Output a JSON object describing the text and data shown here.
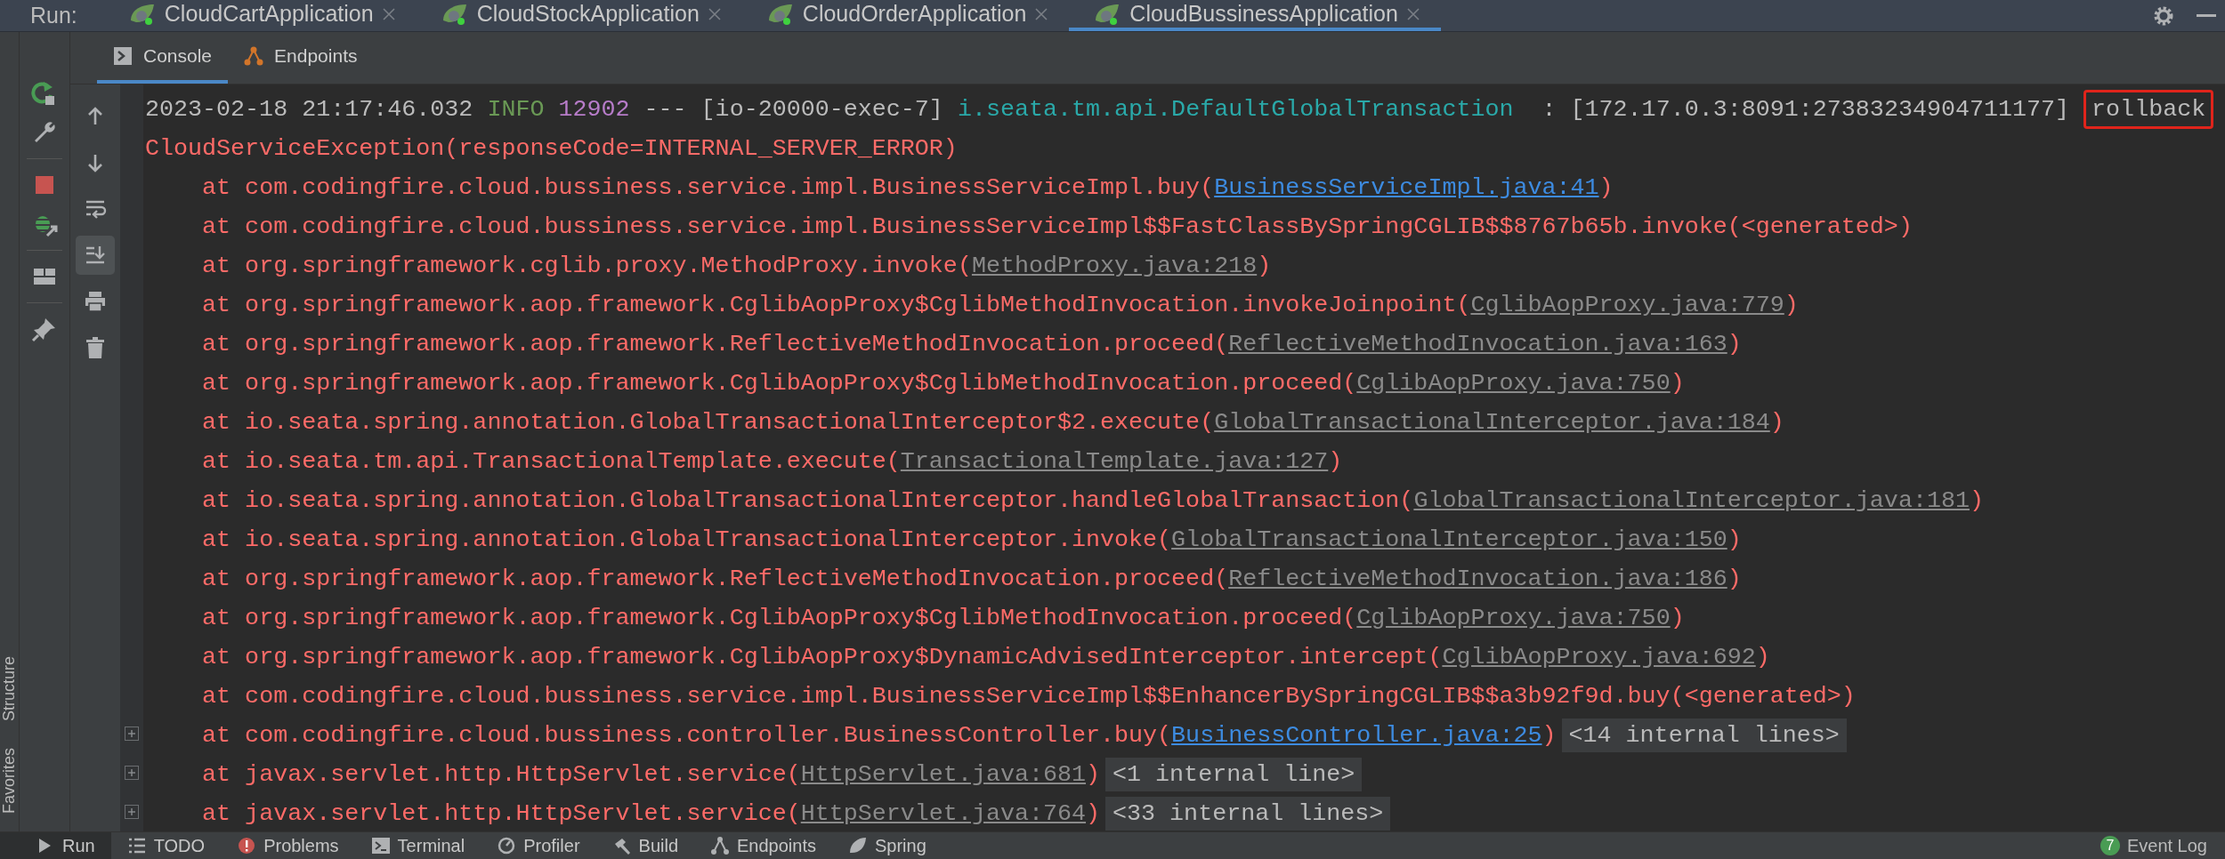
{
  "run_label": "Run:",
  "run_tabs": [
    {
      "label": "CloudCartApplication",
      "selected": false
    },
    {
      "label": "CloudStockApplication",
      "selected": false
    },
    {
      "label": "CloudOrderApplication",
      "selected": false
    },
    {
      "label": "CloudBussinessApplication",
      "selected": true
    }
  ],
  "side_strip": [
    "Structure",
    "Favorites"
  ],
  "run_toolbar": [
    {
      "kind": "rerun"
    },
    {
      "kind": "wrench"
    },
    {
      "kind": "sep"
    },
    {
      "kind": "stop"
    },
    {
      "kind": "debug"
    },
    {
      "kind": "sep"
    },
    {
      "kind": "layout"
    },
    {
      "kind": "sep"
    },
    {
      "kind": "pin"
    }
  ],
  "console_tabs": [
    {
      "label": "Console",
      "kind": "console",
      "selected": true
    },
    {
      "label": "Endpoints",
      "kind": "endpoints",
      "selected": false
    }
  ],
  "console_toolbar": [
    {
      "kind": "up",
      "on": false
    },
    {
      "kind": "down",
      "on": false
    },
    {
      "kind": "wrap",
      "on": false
    },
    {
      "kind": "scroll-end",
      "on": true
    },
    {
      "kind": "print",
      "on": false
    },
    {
      "kind": "trash",
      "on": false
    }
  ],
  "lines": [
    {
      "kind": "log",
      "segments": [
        {
          "text": "2023-02-18 21:17:46.032",
          "kind": "plain"
        },
        {
          "text": "INFO",
          "kind": "level"
        },
        {
          "text": "12902",
          "kind": "pid"
        },
        {
          "text": "--- [io-20000-exec-7]",
          "kind": "plain"
        },
        {
          "text": "i.seata.tm.api.DefaultGlobalTransaction",
          "kind": "logger"
        },
        {
          "text": " : [172.17.0.3:8091:27383234904711177]",
          "kind": "plain"
        },
        {
          "text": "rollback",
          "kind": "marked"
        }
      ]
    },
    {
      "kind": "error",
      "text": "CloudServiceException(responseCode=INTERNAL_SERVER_ERROR)"
    },
    {
      "kind": "frame",
      "text": "at com.codingfire.cloud.bussiness.service.impl.BusinessServiceImpl.buy(",
      "link": "BusinessServiceImpl.java:41",
      "project_link": true,
      "after": ")"
    },
    {
      "kind": "frame",
      "text": "at com.codingfire.cloud.bussiness.service.impl.BusinessServiceImpl$$FastClassBySpringCGLIB$$8767b65b.invoke(<generated>)"
    },
    {
      "kind": "frame",
      "text": "at org.springframework.cglib.proxy.MethodProxy.invoke(",
      "link": "MethodProxy.java:218",
      "project_link": false,
      "after": ")"
    },
    {
      "kind": "frame",
      "text": "at org.springframework.aop.framework.CglibAopProxy$CglibMethodInvocation.invokeJoinpoint(",
      "link": "CglibAopProxy.java:779",
      "project_link": false,
      "after": ")"
    },
    {
      "kind": "frame",
      "text": "at org.springframework.aop.framework.ReflectiveMethodInvocation.proceed(",
      "link": "ReflectiveMethodInvocation.java:163",
      "project_link": false,
      "after": ")"
    },
    {
      "kind": "frame",
      "text": "at org.springframework.aop.framework.CglibAopProxy$CglibMethodInvocation.proceed(",
      "link": "CglibAopProxy.java:750",
      "project_link": false,
      "after": ")"
    },
    {
      "kind": "frame",
      "text": "at io.seata.spring.annotation.GlobalTransactionalInterceptor$2.execute(",
      "link": "GlobalTransactionalInterceptor.java:184",
      "project_link": false,
      "after": ")"
    },
    {
      "kind": "frame",
      "text": "at io.seata.tm.api.TransactionalTemplate.execute(",
      "link": "TransactionalTemplate.java:127",
      "project_link": false,
      "after": ")"
    },
    {
      "kind": "frame",
      "text": "at io.seata.spring.annotation.GlobalTransactionalInterceptor.handleGlobalTransaction(",
      "link": "GlobalTransactionalInterceptor.java:181",
      "project_link": false,
      "after": ")"
    },
    {
      "kind": "frame",
      "text": "at io.seata.spring.annotation.GlobalTransactionalInterceptor.invoke(",
      "link": "GlobalTransactionalInterceptor.java:150",
      "project_link": false,
      "after": ")"
    },
    {
      "kind": "frame",
      "text": "at org.springframework.aop.framework.ReflectiveMethodInvocation.proceed(",
      "link": "ReflectiveMethodInvocation.java:186",
      "project_link": false,
      "after": ")"
    },
    {
      "kind": "frame",
      "text": "at org.springframework.aop.framework.CglibAopProxy$CglibMethodInvocation.proceed(",
      "link": "CglibAopProxy.java:750",
      "project_link": false,
      "after": ")"
    },
    {
      "kind": "frame",
      "text": "at org.springframework.aop.framework.CglibAopProxy$DynamicAdvisedInterceptor.intercept(",
      "link": "CglibAopProxy.java:692",
      "project_link": false,
      "after": ")"
    },
    {
      "kind": "frame",
      "text": "at com.codingfire.cloud.bussiness.service.impl.BusinessServiceImpl$$EnhancerBySpringCGLIB$$a3b92f9d.buy(<generated>)"
    },
    {
      "kind": "frame",
      "text": "at com.codingfire.cloud.bussiness.controller.BusinessController.buy(",
      "link": "BusinessController.java:25",
      "project_link": true,
      "after": ")",
      "folded": "<14 internal lines>",
      "expanded": false
    },
    {
      "kind": "frame",
      "text": "at javax.servlet.http.HttpServlet.service(",
      "link": "HttpServlet.java:681",
      "project_link": false,
      "after": ")",
      "folded": "<1 internal line>",
      "expanded": false
    },
    {
      "kind": "frame",
      "text": "at javax.servlet.http.HttpServlet.service(",
      "link": "HttpServlet.java:764",
      "project_link": false,
      "after": ")",
      "folded": "<33 internal lines>",
      "expanded": false
    }
  ],
  "bottom_tabs": [
    {
      "label": "Run",
      "kind": "run",
      "selected": true
    },
    {
      "label": "TODO",
      "kind": "todo",
      "selected": false
    },
    {
      "label": "Problems",
      "kind": "problems",
      "selected": false
    },
    {
      "label": "Terminal",
      "kind": "terminal",
      "selected": false
    },
    {
      "label": "Profiler",
      "kind": "profiler",
      "selected": false
    },
    {
      "label": "Build",
      "kind": "build",
      "selected": false
    },
    {
      "label": "Endpoints",
      "kind": "endpoints",
      "selected": false
    },
    {
      "label": "Spring",
      "kind": "spring",
      "selected": false
    }
  ],
  "event_log": {
    "count": "7",
    "label": "Event Log"
  }
}
